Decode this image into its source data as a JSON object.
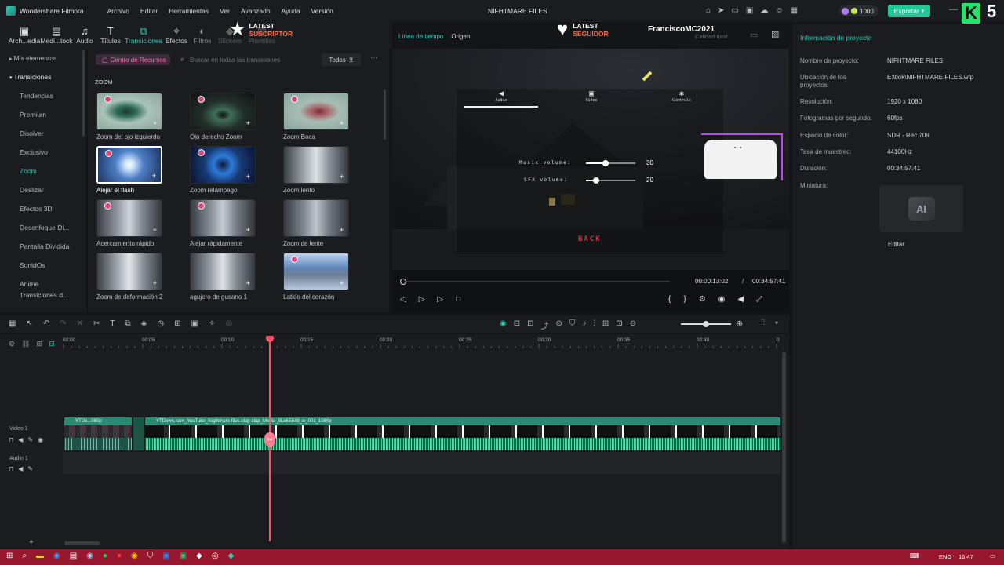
{
  "app": {
    "name": "Wondershare Filmora",
    "project_title": "NIFHTMARE FILES",
    "menu": [
      "Archivo",
      "Editar",
      "Herramientas",
      "Ver",
      "Avanzado",
      "Ayuda",
      "Versión"
    ],
    "credits": "1000",
    "export_label": "Exportar"
  },
  "overlay": {
    "latest_subscriber_top": "LATEST",
    "latest_subscriber_bottom": "SUSCRIPTOR",
    "latest_follower_top": "LATEST",
    "latest_follower_bottom": "SEGUIDOR",
    "channel_name": "FranciscoMC2021",
    "corner_number": "5"
  },
  "toolbar": [
    {
      "label": "Arch...edia",
      "icon": "media-icon"
    },
    {
      "label": "Medi...tock",
      "icon": "stock-icon"
    },
    {
      "label": "Audio",
      "icon": "music-icon"
    },
    {
      "label": "Títulos",
      "icon": "text-icon"
    },
    {
      "label": "Transiciones",
      "icon": "transition-icon"
    },
    {
      "label": "Efectos",
      "icon": "effects-icon"
    },
    {
      "label": "Filtros",
      "icon": "filter-icon"
    },
    {
      "label": "Stickers",
      "icon": "sticker-icon"
    },
    {
      "label": "Plantillas",
      "icon": "template-icon"
    }
  ],
  "left_nav": {
    "my_items": "Mis elementos",
    "transitions": "Transiciones",
    "items": [
      "Tendencias",
      "Premium",
      "Disolver",
      "Exclusivo",
      "Zoom",
      "Deslizar",
      "Efectos 3D",
      "Desenfoque Di...",
      "Pantalla Dividida",
      "SonidOs",
      "Anime",
      "Transiciones d..."
    ],
    "active": "Zoom"
  },
  "resources": {
    "center_label": "Centro de Recursos",
    "search_placeholder": "Buscar en todas las transiciones",
    "filter_label": "Todos",
    "section": "ZOOM",
    "cards": [
      "Zoom del ojo izquierdo",
      "Ojo derecho Zoom",
      "Zoom Boca",
      "Alejar el flash",
      "Zoom relámpago",
      "Zoom lento",
      "Acercamiento rápido",
      "Alejar rápidamente",
      "Zoom de lente",
      "Zoom de deformación 2",
      "agujero de gusano 1",
      "Latido del corazón"
    ]
  },
  "preview": {
    "tab_timeline": "Línea de tiempo",
    "tab_origin": "Origen",
    "quality": "Calidad total",
    "menu_audio": "Audio",
    "menu_video": "Video",
    "menu_controls": "Controls",
    "music_label": "Music volume:",
    "music_value": "30",
    "music_level": 0.4,
    "sfx_label": "SFX volume:",
    "sfx_value": "20",
    "sfx_level": 0.2,
    "back_label": "BACK",
    "current_time": "00:00:13:02",
    "separator": "/",
    "total_time": "00:34:57:41"
  },
  "project_info": {
    "title": "Información de proyecto",
    "rows": [
      {
        "k": "Nombre de proyecto:",
        "v": "NIFHTMARE FILES"
      },
      {
        "k": "Ubicación de los proyectos:",
        "v": "E:\\tiok\\NIFHTMARE FILES.wfp"
      },
      {
        "k": "Resolución:",
        "v": "1920 x 1080"
      },
      {
        "k": "Fotogramas por segundo:",
        "v": "60fps"
      },
      {
        "k": "Espacio de color:",
        "v": "SDR - Rec.709"
      },
      {
        "k": "Tasa de muestreo:",
        "v": "44100Hz"
      },
      {
        "k": "Duración:",
        "v": "00:34:57:41"
      },
      {
        "k": "Miniatura:",
        "v": ""
      }
    ],
    "edit_label": "Editar"
  },
  "timeline": {
    "ruler": [
      "00:00",
      "00:05",
      "00:10",
      "00:15",
      "00:20",
      "00:25",
      "00:30",
      "00:35",
      "00:40",
      "0"
    ],
    "video_track": "Video 1",
    "audio_track": "Audio 1",
    "clip1": "YTDo...080p",
    "clip2": "YTDown.com_YouTube_Nigthmare-files-clap-clap_Media_9Lx6E849_w_001_1080p"
  },
  "taskbar": {
    "lang": "ENG",
    "time": "16:47"
  },
  "colors": {
    "accent": "#2fd0b8",
    "export": "#20c997",
    "playhead": "#ff4f6b"
  }
}
